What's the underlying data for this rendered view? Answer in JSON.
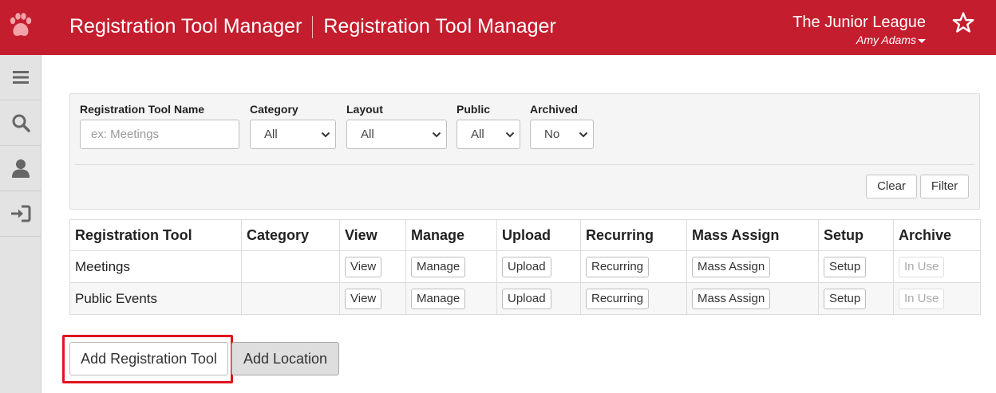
{
  "header": {
    "title_primary": "Registration Tool Manager",
    "title_secondary": "Registration Tool Manager",
    "org_name": "The Junior League",
    "user_name": "Amy Adams",
    "logo_icon": "paw-icon",
    "favorite_icon": "star-outline-icon",
    "brand_color": "#c41e2e"
  },
  "sidebar": {
    "items": [
      {
        "icon": "menu-icon"
      },
      {
        "icon": "search-icon"
      },
      {
        "icon": "user-icon"
      },
      {
        "icon": "logout-icon"
      }
    ]
  },
  "filters": {
    "name_label": "Registration Tool Name",
    "name_placeholder": "ex: Meetings",
    "category_label": "Category",
    "category_value": "All",
    "layout_label": "Layout",
    "layout_value": "All",
    "public_label": "Public",
    "public_value": "All",
    "archived_label": "Archived",
    "archived_value": "No",
    "clear_label": "Clear",
    "filter_label": "Filter"
  },
  "table": {
    "headers": [
      "Registration Tool",
      "Category",
      "View",
      "Manage",
      "Upload",
      "Recurring",
      "Mass Assign",
      "Setup",
      "Archive"
    ],
    "rows": [
      {
        "name": "Meetings",
        "category": "",
        "view": "View",
        "manage": "Manage",
        "upload": "Upload",
        "recurring": "Recurring",
        "mass_assign": "Mass Assign",
        "setup": "Setup",
        "archive": "In Use"
      },
      {
        "name": "Public Events",
        "category": "",
        "view": "View",
        "manage": "Manage",
        "upload": "Upload",
        "recurring": "Recurring",
        "mass_assign": "Mass Assign",
        "setup": "Setup",
        "archive": "In Use"
      }
    ]
  },
  "actions": {
    "add_tool_label": "Add Registration Tool",
    "add_location_label": "Add Location",
    "highlight_color": "#e0141e"
  }
}
